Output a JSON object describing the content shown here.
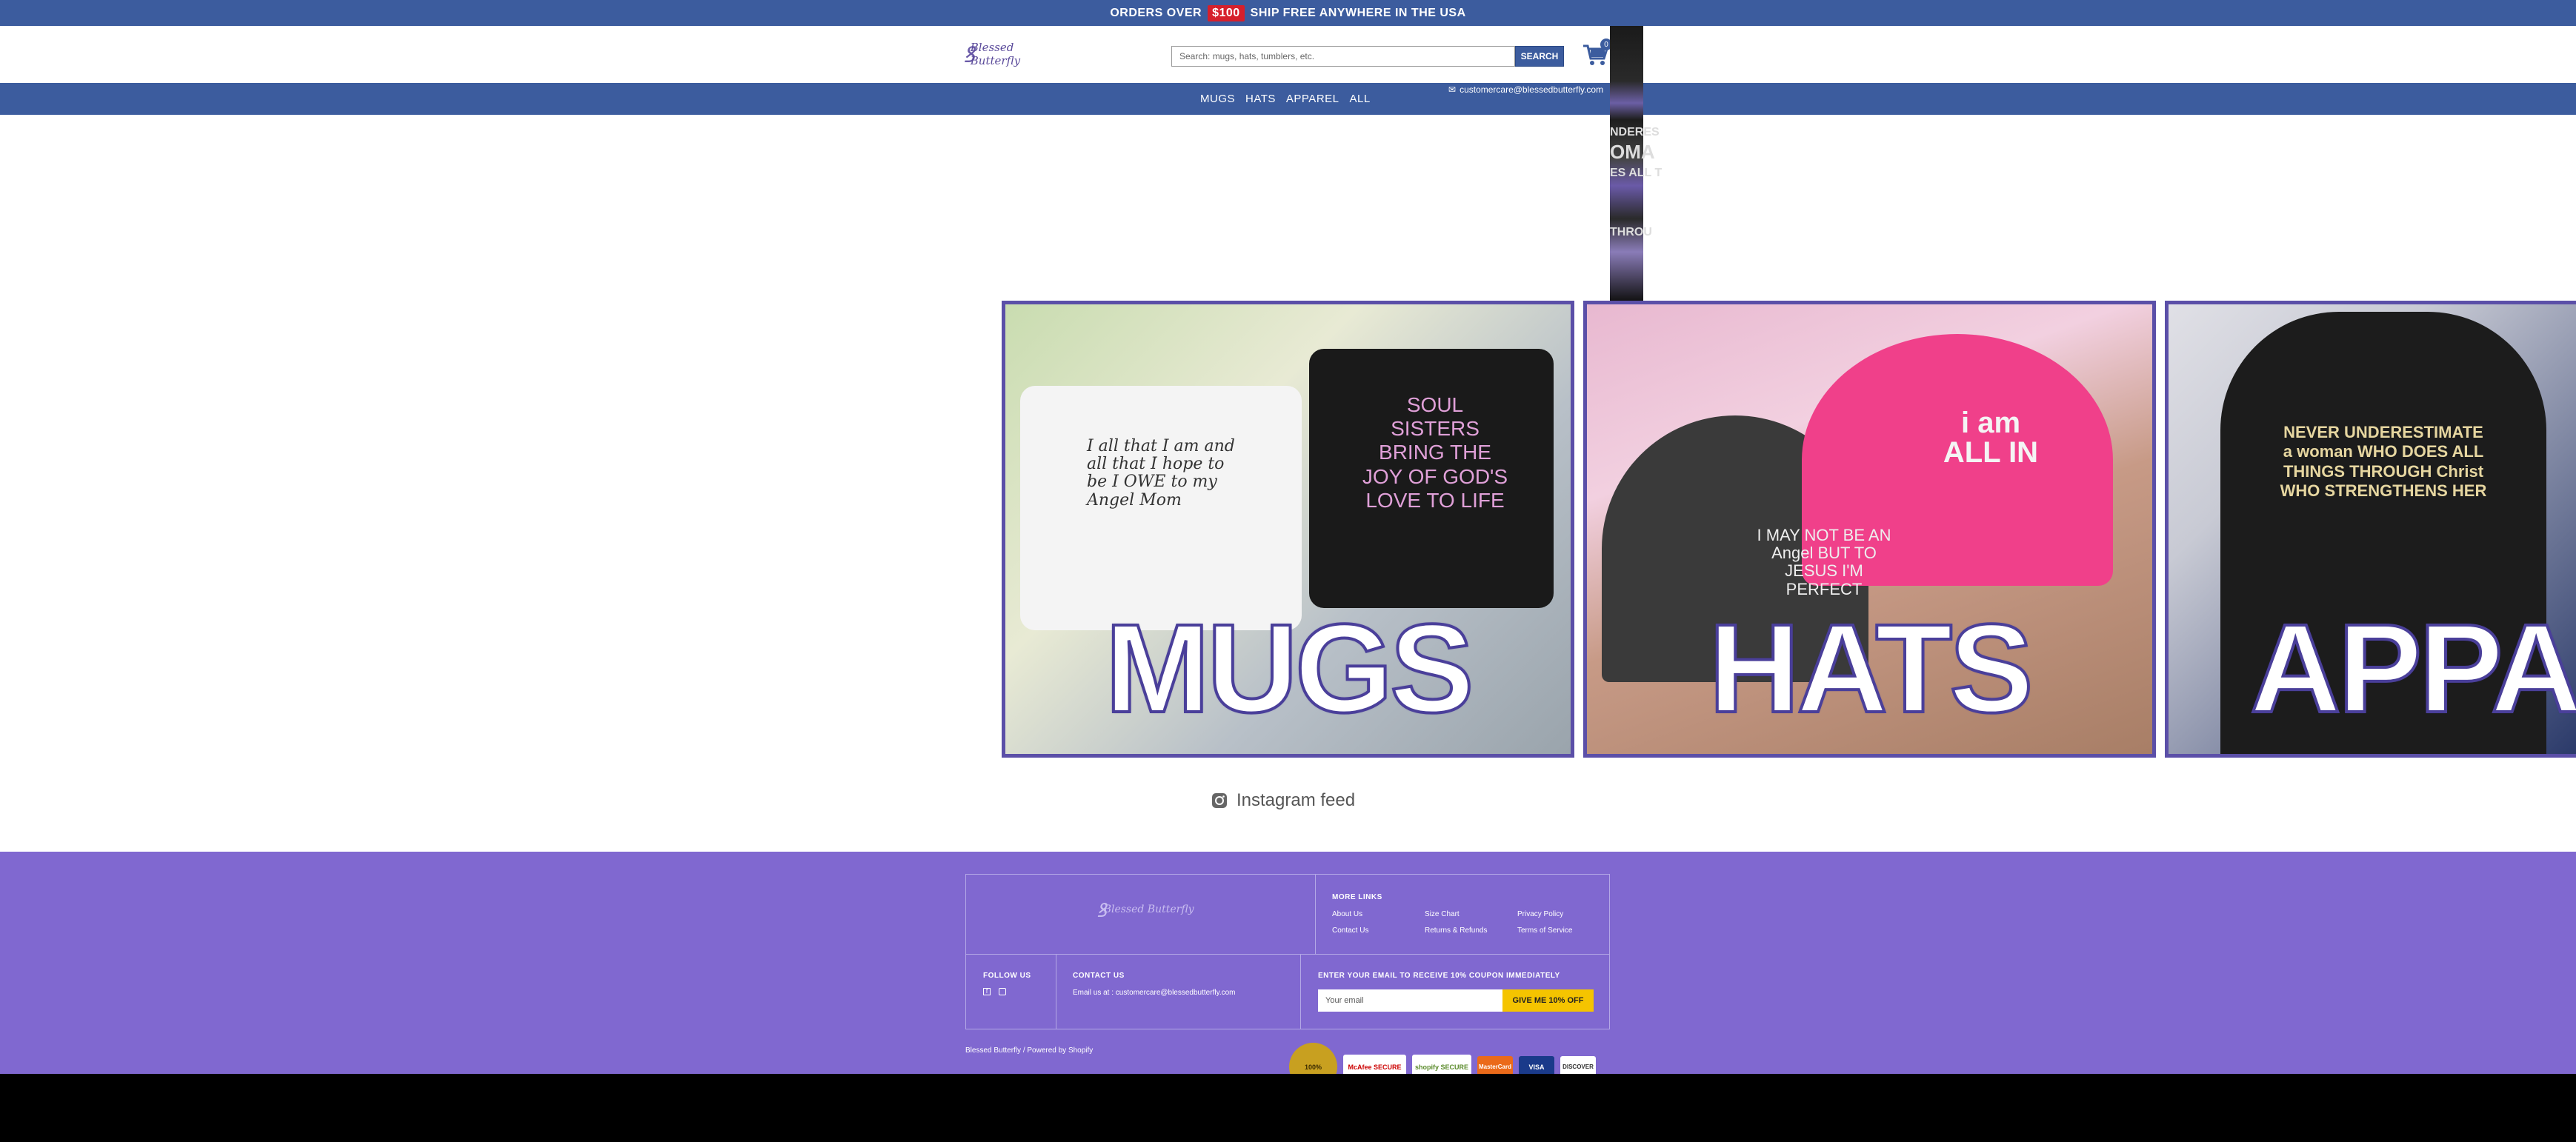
{
  "topbar": {
    "before": "ORDERS OVER",
    "amount": "$100",
    "after": "SHIP FREE ANYWHERE IN THE USA"
  },
  "header": {
    "logo": "Blessed Butterfly",
    "search_placeholder": "Search: mugs, hats, tumblers, etc.",
    "search_button": "SEARCH",
    "cart_count": "0",
    "email": "customercare@blessedbutterfly.com"
  },
  "nav": [
    {
      "label": "MUGS"
    },
    {
      "label": "HATS"
    },
    {
      "label": "APPAREL"
    },
    {
      "label": "ALL"
    }
  ],
  "strip_text": [
    "NDERES",
    "OMA",
    "ES ALL T",
    "THROU"
  ],
  "tiles": [
    {
      "title": "MUGS",
      "mug1": "I all that I am and all that I hope to be I OWE to my Angel Mom",
      "mug2": "SOUL SISTERS BRING THE JOY OF GOD'S LOVE TO LIFE"
    },
    {
      "title": "HATS",
      "hat1": "I MAY NOT BE AN Angel BUT TO JESUS I'M PERFECT",
      "hat2": "i am ALL IN"
    },
    {
      "title": "APPAREL",
      "shirt": "NEVER UNDERESTIMATE a woman WHO DOES ALL THINGS THROUGH Christ WHO STRENGTHENS HER"
    }
  ],
  "instagram": "Instagram feed",
  "footer": {
    "logo": "Blessed Butterfly",
    "more_links_title": "MORE LINKS",
    "links": [
      "About Us",
      "Size Chart",
      "Privacy Policy",
      "Contact Us",
      "Returns & Refunds",
      "Terms of Service"
    ],
    "follow_title": "FOLLOW US",
    "contact_title": "CONTACT US",
    "contact_text": "Email us at : customercare@blessedbutterfly.com",
    "coupon_title": "ENTER YOUR EMAIL TO RECEIVE 10% COUPON IMMEDIATELY",
    "email_placeholder": "Your email",
    "coupon_button": "GIVE ME 10% OFF",
    "copyright": "Blessed Butterfly / Powered by Shopify",
    "badges": [
      "100%",
      "McAfee SECURE",
      "shopify SECURE",
      "MasterCard",
      "VISA",
      "DISCOVER"
    ]
  }
}
